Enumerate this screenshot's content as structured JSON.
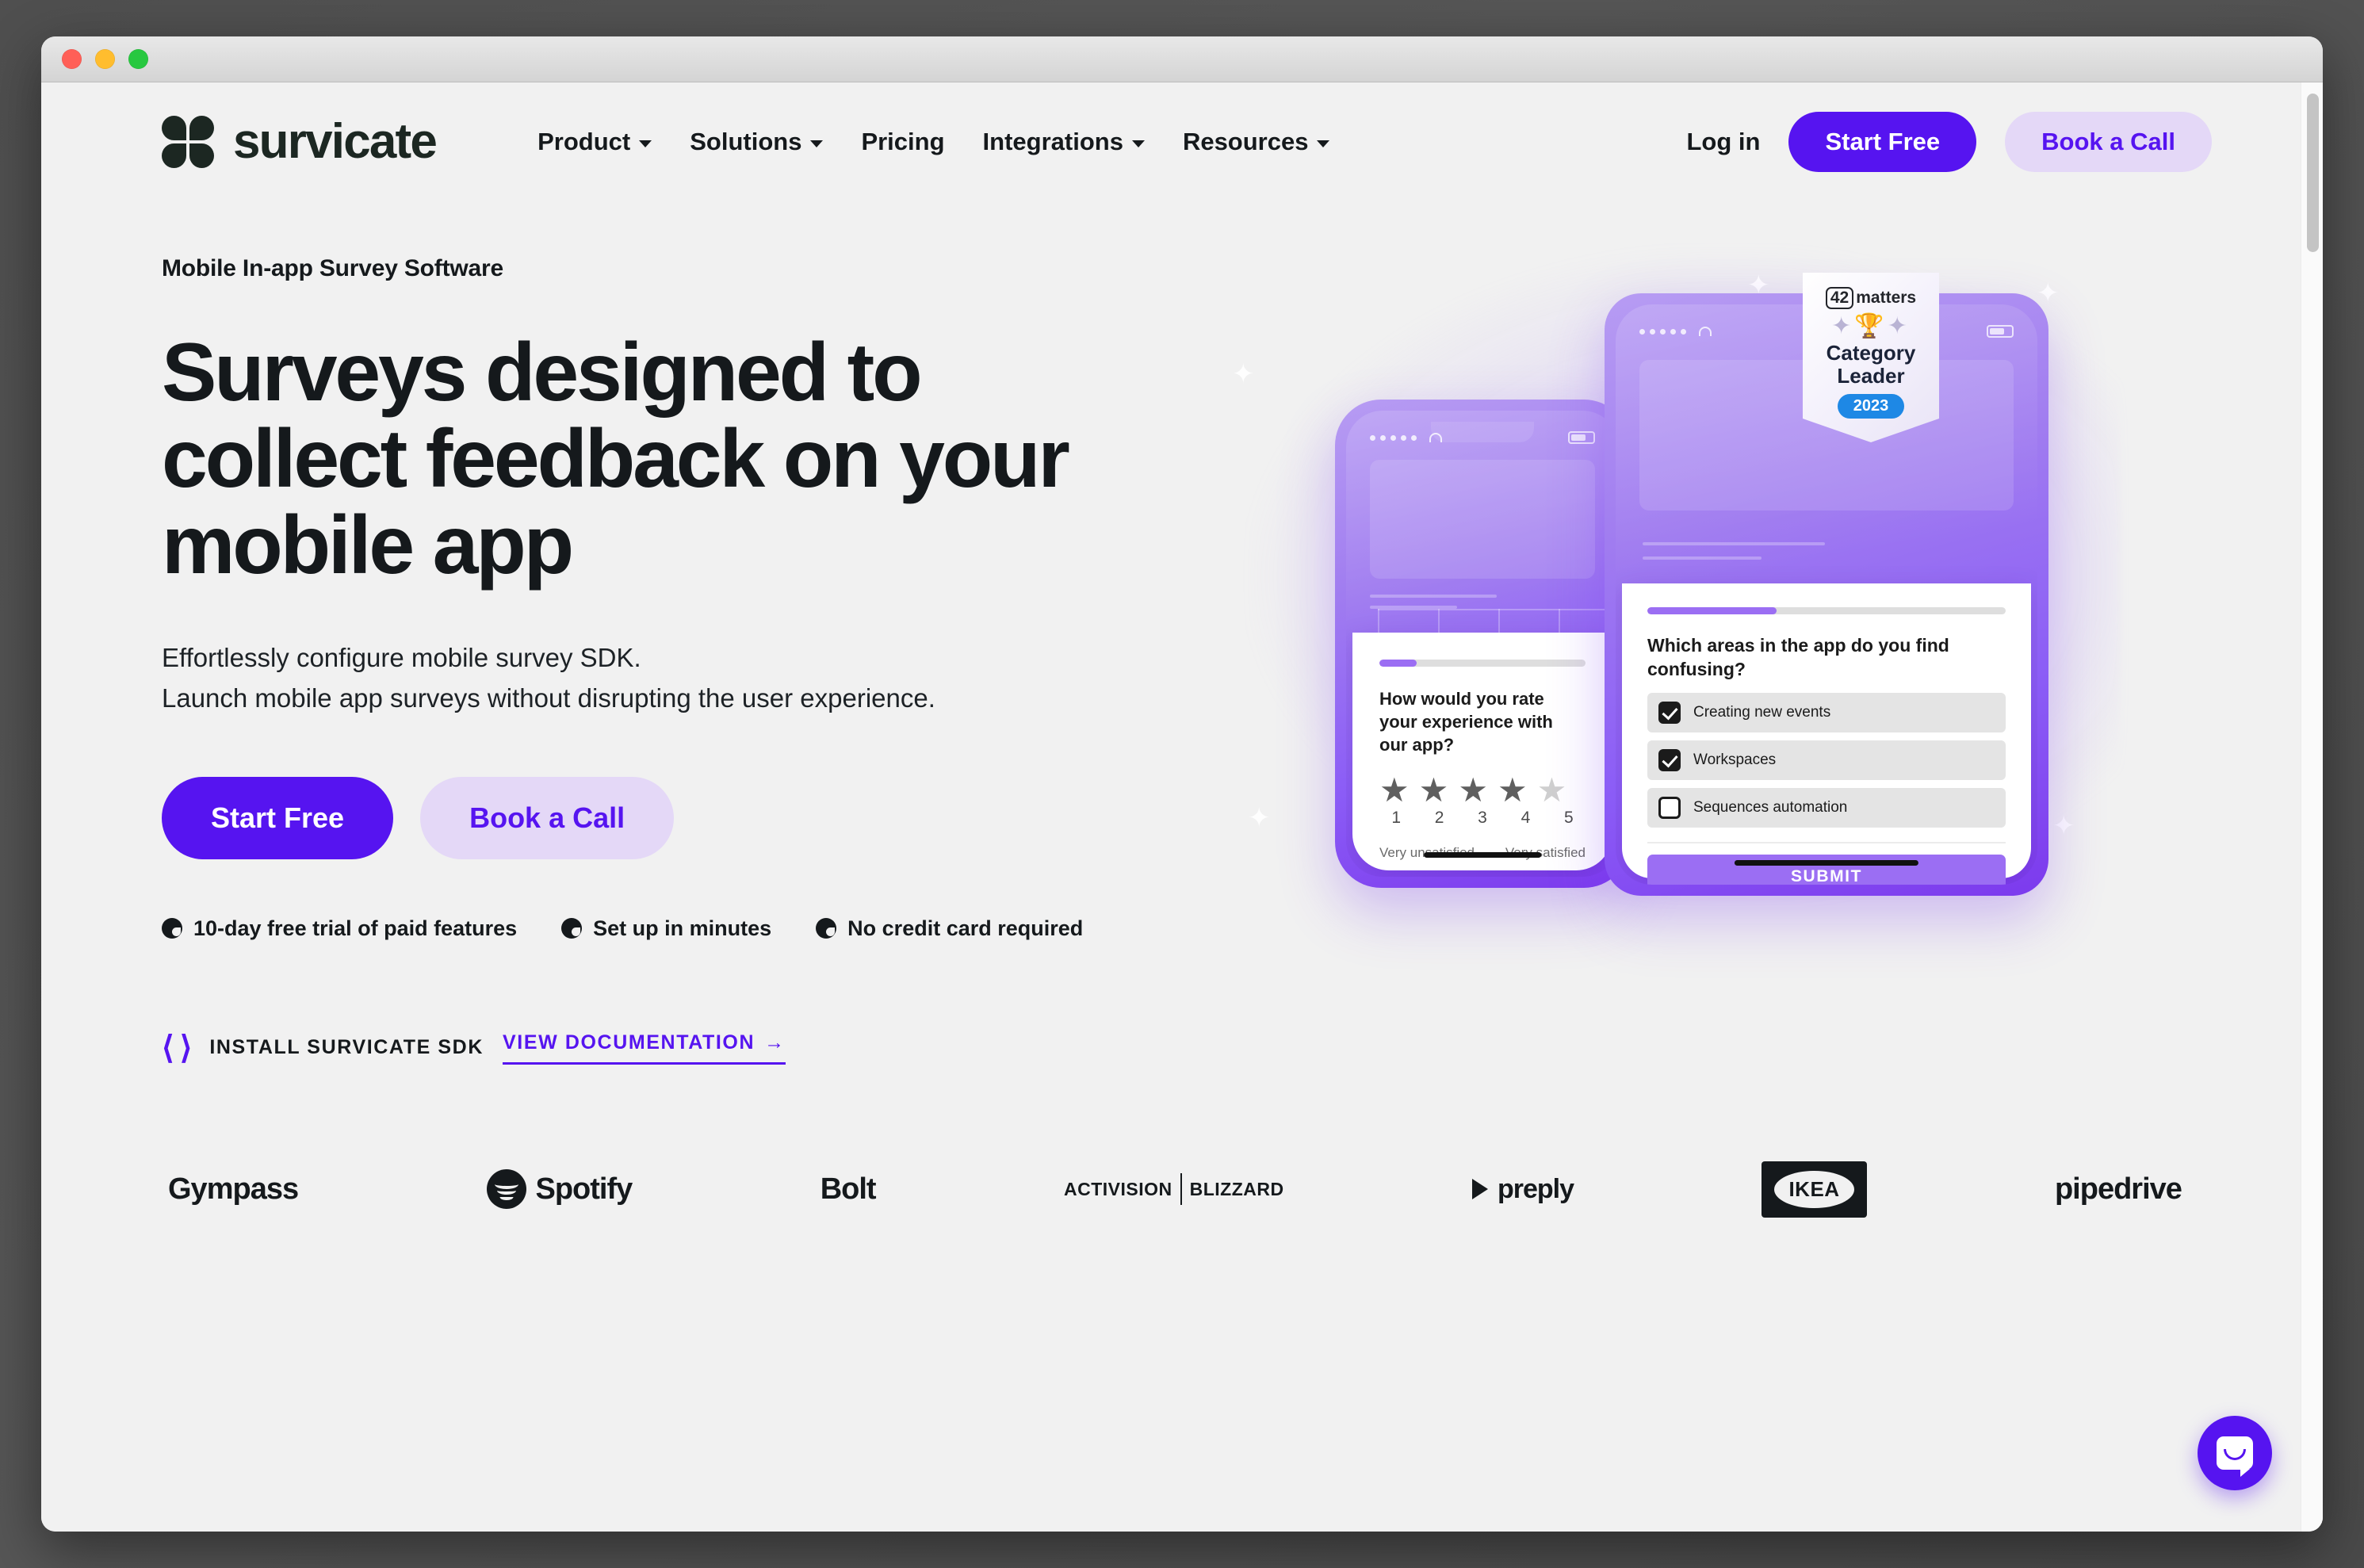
{
  "window": {
    "controls": [
      "close",
      "minimize",
      "maximize"
    ]
  },
  "nav": {
    "logo_text": "survicate",
    "links": [
      {
        "label": "Product",
        "has_dropdown": true
      },
      {
        "label": "Solutions",
        "has_dropdown": true
      },
      {
        "label": "Pricing",
        "has_dropdown": false
      },
      {
        "label": "Integrations",
        "has_dropdown": true
      },
      {
        "label": "Resources",
        "has_dropdown": true
      }
    ],
    "login_label": "Log in",
    "start_free_label": "Start Free",
    "book_call_label": "Book a Call"
  },
  "hero": {
    "eyebrow": "Mobile In-app Survey Software",
    "headline_line1": "Surveys designed to",
    "headline_line2": "collect feedback on your",
    "headline_line3": "mobile app",
    "subtext_line1": "Effortlessly configure mobile survey SDK.",
    "subtext_line2": "Launch mobile app surveys without disrupting the user experience.",
    "cta_primary": "Start Free",
    "cta_secondary": "Book a Call",
    "bullets": [
      "10-day free trial of paid features",
      "Set up in minutes",
      "No credit card required"
    ],
    "sdk_label": "INSTALL SURVICATE SDK",
    "doc_link": "VIEW DOCUMENTATION",
    "doc_link_arrow": "→"
  },
  "illustration": {
    "phone_survey": {
      "question": "How would you rate your experience with our app?",
      "progress_percent": 18,
      "stars_filled": 4,
      "stars_total": 5,
      "numbers": [
        "1",
        "2",
        "3",
        "4",
        "5"
      ],
      "label_low": "Very unsatisfied",
      "label_high": "Very satisfied"
    },
    "tablet_survey": {
      "question": "Which areas in the app do you find confusing?",
      "progress_percent": 36,
      "options": [
        {
          "label": "Creating new events",
          "checked": true
        },
        {
          "label": "Workspaces",
          "checked": true
        },
        {
          "label": "Sequences automation",
          "checked": false
        }
      ],
      "submit_label": "SUBMIT"
    },
    "badge": {
      "brand_num": "42",
      "brand_word": "matters",
      "title_line1": "Category",
      "title_line2": "Leader",
      "year": "2023",
      "trophy_glyph": "✦🏆✦"
    }
  },
  "clients": [
    {
      "name": "Gympass",
      "type": "word"
    },
    {
      "name": "Spotify",
      "type": "spotify"
    },
    {
      "name": "Bolt",
      "type": "word"
    },
    {
      "name": "ACTIVISION",
      "name2": "BLIZZARD",
      "type": "activision"
    },
    {
      "name": "preply",
      "type": "preply"
    },
    {
      "name": "IKEA",
      "type": "ikea"
    },
    {
      "name": "pipedrive",
      "type": "word"
    }
  ],
  "colors": {
    "brand_purple": "#5614f0",
    "soft_purple": "#e4d8f7",
    "ink": "#15191c",
    "page_bg": "#f1f1f1",
    "device_purple": "#8b5cf6",
    "badge_blue": "#1e88e5"
  },
  "chat": {
    "label": "Open chat"
  }
}
